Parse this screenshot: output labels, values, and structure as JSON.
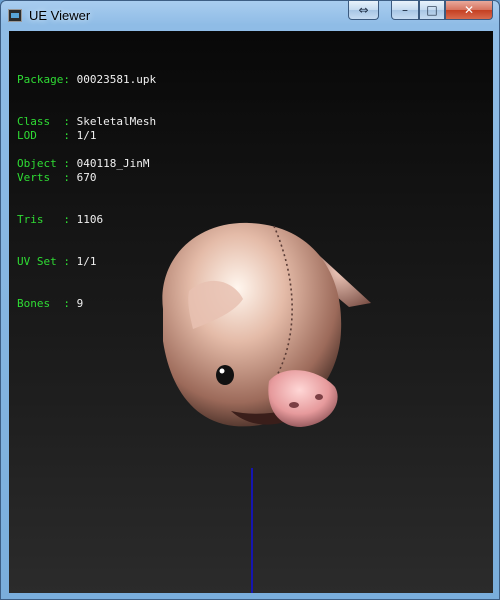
{
  "window": {
    "title": "UE Viewer",
    "controls": {
      "extra": "⇔",
      "minimize": "–",
      "maximize": "□",
      "close": "✕"
    }
  },
  "info": {
    "group1": [
      {
        "key": "Package",
        "sep": ": ",
        "value": "00023581.upk"
      },
      {
        "key": "Class  ",
        "sep": ": ",
        "value": "SkeletalMesh"
      },
      {
        "key": "Object ",
        "sep": ": ",
        "value": "040118_JinM"
      }
    ],
    "group2": [
      {
        "key": "LOD    ",
        "sep": ": ",
        "value": "1/1"
      },
      {
        "key": "Verts  ",
        "sep": ": ",
        "value": "670"
      },
      {
        "key": "Tris   ",
        "sep": ": ",
        "value": "1106"
      },
      {
        "key": "UV Set ",
        "sep": ": ",
        "value": "1/1"
      },
      {
        "key": "Bones  ",
        "sep": ": ",
        "value": "9"
      }
    ]
  },
  "colors": {
    "label": "#2fdc34",
    "value": "#f0f0f0",
    "axis": "#1515b0"
  }
}
